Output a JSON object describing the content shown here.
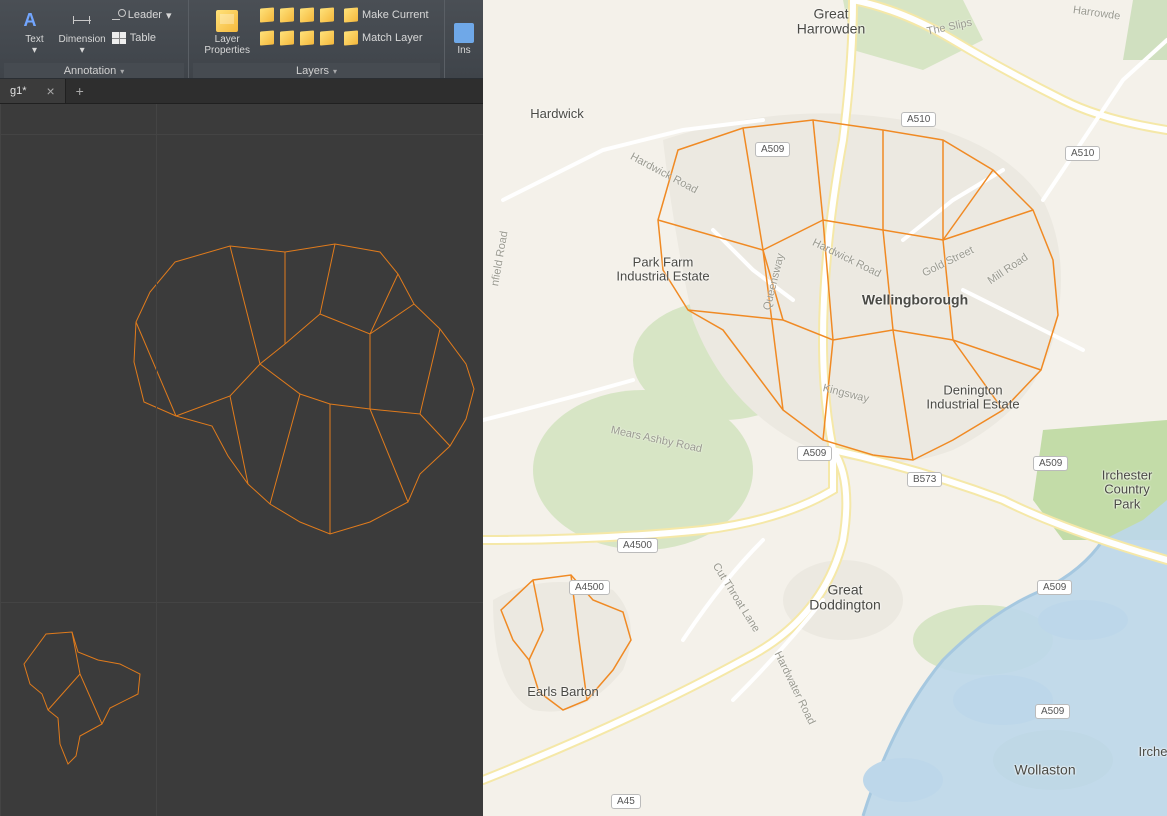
{
  "ribbon": {
    "annotation": {
      "title": "Annotation",
      "text_btn": "Text",
      "dimension_btn": "Dimension",
      "leader_btn": "Leader",
      "table_btn": "Table"
    },
    "layers": {
      "title": "Layers",
      "layer_props_btn": "Layer\nProperties",
      "make_current_btn": "Make Current",
      "match_layer_btn": "Match Layer"
    },
    "insert_partial": "Ins"
  },
  "tabs": {
    "file1": "g1*"
  },
  "map": {
    "places": {
      "great_harrowden": "Great\nHarrowden",
      "hardwick": "Hardwick",
      "park_farm": "Park Farm\nIndustrial Estate",
      "wellingborough": "Wellingborough",
      "denington": "Denington\nIndustrial Estate",
      "great_doddington": "Great\nDoddington",
      "earls_barton": "Earls Barton",
      "wollaston": "Wollaston",
      "irchester_park": "Irchester\nCountry Park",
      "irche": "Irche"
    },
    "shields": {
      "a510a": "A510",
      "a510b": "A510",
      "a509a": "A509",
      "a509b": "A509",
      "a509c": "A509",
      "a509d": "A509",
      "a509e": "A509",
      "b573": "B573",
      "a4500a": "A4500",
      "a4500b": "A4500",
      "a45a": "A45"
    },
    "roads": {
      "the_slips": "The Slips",
      "harrowde": "Harrowde",
      "hardwick_rd": "Hardwick Road",
      "hardwick_rd2": "Hardwick Road",
      "gold_street": "Gold Street",
      "mill_road": "Mill Road",
      "kingsway": "Kingsway",
      "queensway": "Queensway",
      "mears_ashby": "Mears Ashby Road",
      "cut_throat": "Cut Throat Lane",
      "hardwater": "Hardwater Road",
      "nfield_road": "nfield Road"
    }
  }
}
